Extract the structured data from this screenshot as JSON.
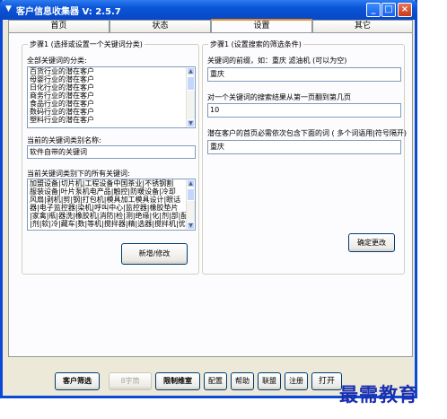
{
  "window": {
    "title": "客户信息收集器 V: 2.5.7"
  },
  "tabs": [
    {
      "label": "首页"
    },
    {
      "label": "状态"
    },
    {
      "label": "设置"
    },
    {
      "label": "其它"
    }
  ],
  "step1": {
    "title": "步骤1 (选择或设置一个关键词分类)",
    "all_categories_label": "全部关键词的分类:",
    "categories": [
      "百货行业的潜在客户",
      "母婴行业的潜在客户",
      "日化行业的潜在客户",
      "商务行业的潜在客户",
      "食品行业的潜在客户",
      "数码行业的潜在客户",
      "塑料行业的潜在客户"
    ],
    "current_category_label": "当前的关键词类别名称:",
    "current_category_value": "软件自带的关键词",
    "keywords_label": "当前关键词类别下的所有关键词:",
    "keywords_lines": [
      "加盟设备|切片机|工程设备中国茶业|不锈钢割",
      "服装设备|叶片泵机电产品|触控|防暖设备|冷却",
      "风扇|剥机|剪|钢|打包机|模具加工模具设计|眼话",
      "器|电子监控器|染机|呼叫中心|监控器|橡胶垫片",
      "|家禽|瓶|器洗|橡胶机|消防|检|测|绝缘|化|剂|部|配|客",
      "|剂|软|冷|藏车|数|等机|搅拌器|精|选器|搅拌机|优质"
    ],
    "add_edit_button": "新增/修改"
  },
  "step2": {
    "title": "步骤1 (设置搜索的筛选条件)",
    "prefix_label": "关键词的前缀，如：重庆 滤油机 (可以为空)",
    "prefix_value": "重庆",
    "pages_label": "对一个关键词的搜索结果从第一页翻到第几页",
    "pages_value": "10",
    "homepage_label": "潜在客户的首页必需依次包含下面的词 ( 多个词语用|符号隔开)",
    "homepage_value": "重庆",
    "confirm_button": "确定更改"
  },
  "bottom_buttons": [
    {
      "label": "客户筛选",
      "bold": true,
      "disabled": false
    },
    {
      "label": "8字筒",
      "bold": false,
      "disabled": true
    },
    {
      "label": "限制维室",
      "bold": true,
      "disabled": false
    },
    {
      "label": "配置",
      "bold": false,
      "disabled": false
    },
    {
      "label": "帮助",
      "bold": false,
      "disabled": false
    },
    {
      "label": "联盟",
      "bold": false,
      "disabled": false
    },
    {
      "label": "注册",
      "bold": false,
      "disabled": false
    },
    {
      "label": "打开",
      "bold": false,
      "disabled": false
    }
  ],
  "watermark": "最需教育",
  "colors": {
    "titlebar": "#0a55d8",
    "tab_active_accent": "#e68b2c",
    "window_bg": "#ece9d8",
    "watermark": "#1a2fb0"
  }
}
